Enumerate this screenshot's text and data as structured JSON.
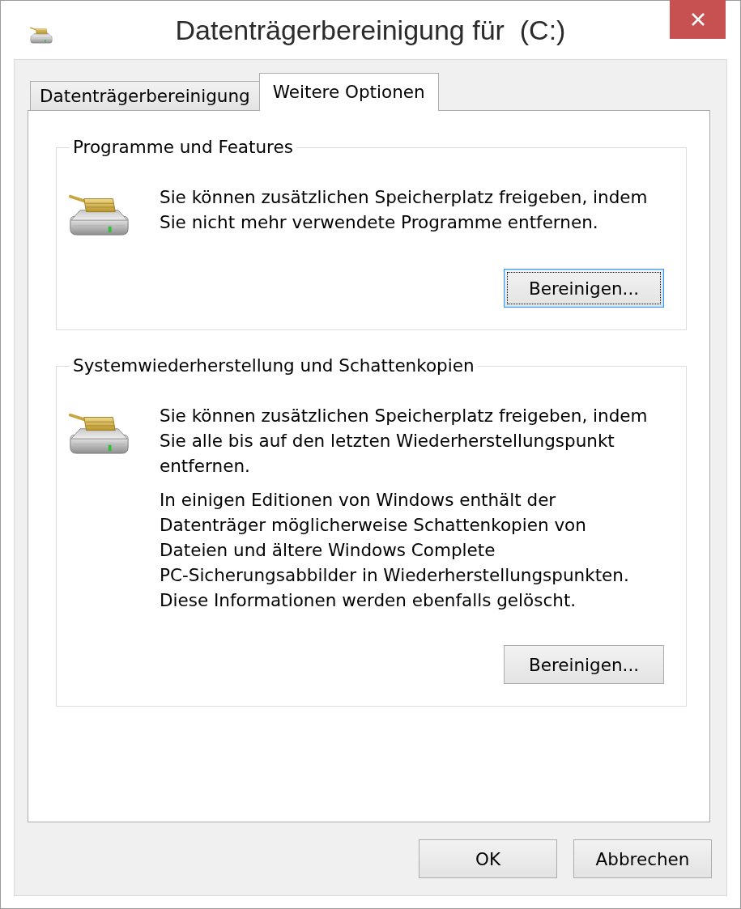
{
  "window": {
    "title": "Datenträgerbereinigung für  (C:)"
  },
  "tabs": [
    {
      "label": "Datenträgerbereinigung",
      "selected": false
    },
    {
      "label": "Weitere Optionen",
      "selected": true
    }
  ],
  "groups": [
    {
      "title": "Programme und Features",
      "paragraphs": [
        "Sie können zusätzlichen Speicherplatz freigeben, indem\nSie nicht mehr verwendete Programme entfernen."
      ],
      "button": {
        "label": "Bereinigen...",
        "focused": true
      }
    },
    {
      "title": "Systemwiederherstellung und Schattenkopien",
      "paragraphs": [
        "Sie können zusätzlichen Speicherplatz freigeben, indem\nSie alle bis auf den letzten Wiederherstellungspunkt\nentfernen.",
        "In einigen Editionen von Windows enthält der\nDatenträger möglicherweise Schattenkopien von\nDateien und ältere Windows Complete\nPC-Sicherungsabbilder in Wiederherstellungspunkten.\nDiese Informationen werden ebenfalls gelöscht."
      ],
      "button": {
        "label": "Bereinigen...",
        "focused": false
      }
    }
  ],
  "buttons": [
    {
      "label": "OK"
    },
    {
      "label": "Abbrechen"
    }
  ]
}
